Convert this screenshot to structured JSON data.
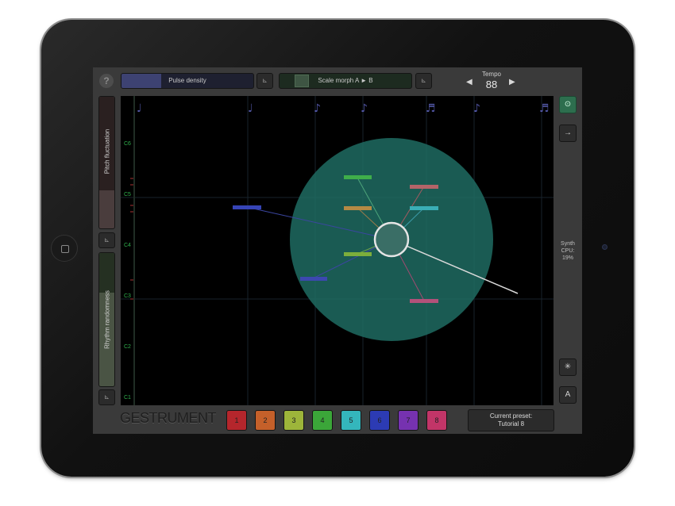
{
  "app": {
    "logo": "GESTRUMENT"
  },
  "topbar": {
    "help_icon": "?",
    "pulse_density": {
      "label": "Pulse density",
      "level": 0.3
    },
    "scale_morph": {
      "label": "Scale morph  A ► B",
      "level": 0.12
    },
    "settings_glyph": "⊾",
    "tempo": {
      "label": "Tempo",
      "value": "88",
      "left_arrow": "◀",
      "right_arrow": "▶"
    }
  },
  "left_sliders": {
    "pitch_fluctuation": {
      "label": "Pitch fluctuation",
      "level": 0.3
    },
    "rhythm_randomness": {
      "label": "Rhythm randomness",
      "level": 0.7
    }
  },
  "canvas": {
    "pitch_labels": [
      "C6",
      "C5",
      "C4",
      "C3",
      "C2",
      "C1"
    ],
    "colors": {
      "background": "#000000",
      "circle": "#1f6b62",
      "grid": "#1c2630"
    }
  },
  "right_column": {
    "top_button": "⊙",
    "arrow_button": "→",
    "synth": [
      "Synth",
      "CPU:",
      "19%"
    ],
    "star_button": "✳",
    "a_button": "A"
  },
  "presets": [
    {
      "label": "1",
      "color": "#b5262c"
    },
    {
      "label": "2",
      "color": "#c5602a"
    },
    {
      "label": "3",
      "color": "#9db53a"
    },
    {
      "label": "4",
      "color": "#3ba639"
    },
    {
      "label": "5",
      "color": "#34b6bc"
    },
    {
      "label": "6",
      "color": "#2c3bb4"
    },
    {
      "label": "7",
      "color": "#7632b0"
    },
    {
      "label": "8",
      "color": "#c23568"
    }
  ],
  "current_preset": {
    "line1": "Current preset:",
    "line2": "Tutorial 8"
  }
}
